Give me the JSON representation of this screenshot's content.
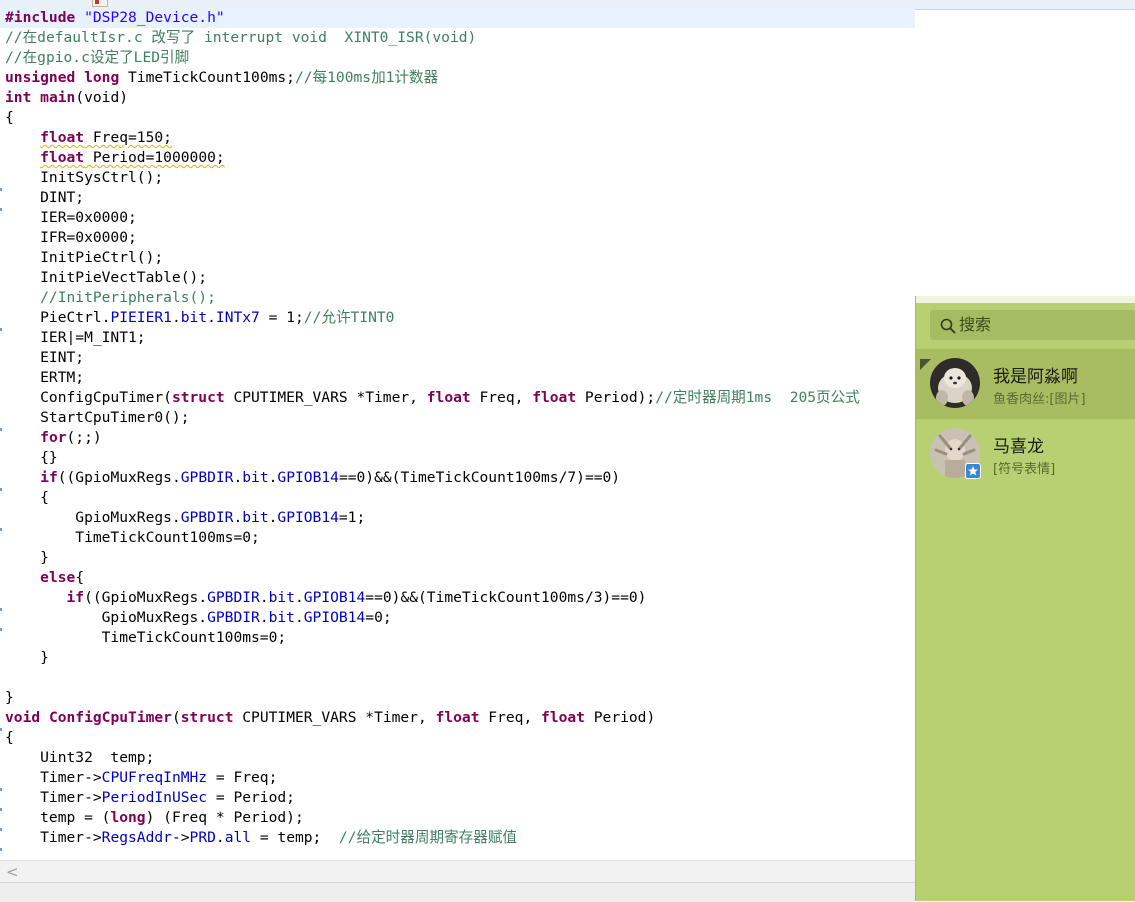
{
  "editor": {
    "lines": [
      [
        {
          "t": "#include ",
          "c": "kw"
        },
        {
          "t": "\"DSP28_Device.h\"",
          "c": "str"
        }
      ],
      [
        {
          "t": "//在defaultIsr.c 改写了 interrupt void  XINT0_ISR(void)",
          "c": "cm"
        }
      ],
      [
        {
          "t": "//在gpio.c设定了LED引脚",
          "c": "cm"
        }
      ],
      [
        {
          "t": "unsigned",
          "c": "kw"
        },
        {
          "t": " "
        },
        {
          "t": "long",
          "c": "kw"
        },
        {
          "t": " TimeTickCount100ms;"
        },
        {
          "t": "//每100ms加1计数器",
          "c": "cm"
        }
      ],
      [
        {
          "t": "int",
          "c": "kw"
        },
        {
          "t": " "
        },
        {
          "t": "main",
          "c": "kw"
        },
        {
          "t": "(void)"
        }
      ],
      [
        {
          "t": "{"
        }
      ],
      [
        {
          "t": "    "
        },
        {
          "t": "float",
          "c": "kw sq"
        },
        {
          "t": " Freq=150;",
          "c": "sq"
        }
      ],
      [
        {
          "t": "    "
        },
        {
          "t": "float",
          "c": "kw sq"
        },
        {
          "t": " Period=1000000;",
          "c": "sq"
        }
      ],
      [
        {
          "t": "    InitSysCtrl();"
        }
      ],
      [
        {
          "t": "    DINT;"
        }
      ],
      [
        {
          "t": "    IER=0x0000;"
        }
      ],
      [
        {
          "t": "    IFR=0x0000;"
        }
      ],
      [
        {
          "t": "    InitPieCtrl();"
        }
      ],
      [
        {
          "t": "    InitPieVectTable();"
        }
      ],
      [
        {
          "t": "    //InitPeripherals();",
          "c": "cm"
        }
      ],
      [
        {
          "t": "    PieCtrl."
        },
        {
          "t": "PIEIER1",
          "c": "fld"
        },
        {
          "t": "."
        },
        {
          "t": "bit",
          "c": "fld"
        },
        {
          "t": "."
        },
        {
          "t": "INTx7",
          "c": "fld"
        },
        {
          "t": " = 1;"
        },
        {
          "t": "//允许TINT0",
          "c": "cm"
        }
      ],
      [
        {
          "t": "    IER|=M_INT1;"
        }
      ],
      [
        {
          "t": "    EINT;"
        }
      ],
      [
        {
          "t": "    ERTM;"
        }
      ],
      [
        {
          "t": "    ConfigCpuTimer("
        },
        {
          "t": "struct",
          "c": "kw"
        },
        {
          "t": " CPUTIMER_VARS *Timer, "
        },
        {
          "t": "float",
          "c": "kw"
        },
        {
          "t": " Freq, "
        },
        {
          "t": "float",
          "c": "kw"
        },
        {
          "t": " Period);"
        },
        {
          "t": "//定时器周期1ms  205页公式",
          "c": "cm"
        }
      ],
      [
        {
          "t": "    StartCpuTimer0();"
        }
      ],
      [
        {
          "t": "    "
        },
        {
          "t": "for",
          "c": "kw"
        },
        {
          "t": "(;;)"
        }
      ],
      [
        {
          "t": "    {}"
        }
      ],
      [
        {
          "t": "    "
        },
        {
          "t": "if",
          "c": "kw"
        },
        {
          "t": "((GpioMuxRegs."
        },
        {
          "t": "GPBDIR",
          "c": "fld"
        },
        {
          "t": "."
        },
        {
          "t": "bit",
          "c": "fld"
        },
        {
          "t": "."
        },
        {
          "t": "GPIOB14",
          "c": "fld"
        },
        {
          "t": "==0)&&(TimeTickCount100ms/7)==0)"
        }
      ],
      [
        {
          "t": "    {"
        }
      ],
      [
        {
          "t": "        GpioMuxRegs."
        },
        {
          "t": "GPBDIR",
          "c": "fld"
        },
        {
          "t": "."
        },
        {
          "t": "bit",
          "c": "fld"
        },
        {
          "t": "."
        },
        {
          "t": "GPIOB14",
          "c": "fld"
        },
        {
          "t": "=1;"
        }
      ],
      [
        {
          "t": "        TimeTickCount100ms=0;"
        }
      ],
      [
        {
          "t": "    }"
        }
      ],
      [
        {
          "t": "    "
        },
        {
          "t": "else",
          "c": "kw"
        },
        {
          "t": "{"
        }
      ],
      [
        {
          "t": "       "
        },
        {
          "t": "if",
          "c": "kw"
        },
        {
          "t": "((GpioMuxRegs."
        },
        {
          "t": "GPBDIR",
          "c": "fld"
        },
        {
          "t": "."
        },
        {
          "t": "bit",
          "c": "fld"
        },
        {
          "t": "."
        },
        {
          "t": "GPIOB14",
          "c": "fld"
        },
        {
          "t": "==0)&&(TimeTickCount100ms/3)==0)"
        }
      ],
      [
        {
          "t": "           GpioMuxRegs."
        },
        {
          "t": "GPBDIR",
          "c": "fld"
        },
        {
          "t": "."
        },
        {
          "t": "bit",
          "c": "fld"
        },
        {
          "t": "."
        },
        {
          "t": "GPIOB14",
          "c": "fld"
        },
        {
          "t": "=0;"
        }
      ],
      [
        {
          "t": "           TimeTickCount100ms=0;"
        }
      ],
      [
        {
          "t": "    }"
        }
      ],
      [
        {
          "t": ""
        }
      ],
      [
        {
          "t": "}"
        }
      ],
      [
        {
          "t": "void",
          "c": "kw"
        },
        {
          "t": " "
        },
        {
          "t": "ConfigCpuTimer",
          "c": "kw"
        },
        {
          "t": "("
        },
        {
          "t": "struct",
          "c": "kw"
        },
        {
          "t": " CPUTIMER_VARS *Timer, "
        },
        {
          "t": "float",
          "c": "kw"
        },
        {
          "t": " Freq, "
        },
        {
          "t": "float",
          "c": "kw"
        },
        {
          "t": " Period)"
        }
      ],
      [
        {
          "t": "{"
        }
      ],
      [
        {
          "t": "    Uint32  temp;"
        }
      ],
      [
        {
          "t": "    Timer->"
        },
        {
          "t": "CPUFreqInMHz",
          "c": "fld"
        },
        {
          "t": " = Freq;"
        }
      ],
      [
        {
          "t": "    Timer->"
        },
        {
          "t": "PeriodInUSec",
          "c": "fld"
        },
        {
          "t": " = Period;"
        }
      ],
      [
        {
          "t": "    temp = ("
        },
        {
          "t": "long",
          "c": "kw"
        },
        {
          "t": ") (Freq * Period);"
        }
      ],
      [
        {
          "t": "    Timer->"
        },
        {
          "t": "RegsAddr",
          "c": "fld"
        },
        {
          "t": "->"
        },
        {
          "t": "PRD",
          "c": "fld"
        },
        {
          "t": "."
        },
        {
          "t": "all",
          "c": "fld"
        },
        {
          "t": " = temp;  "
        },
        {
          "t": "//给定时器周期寄存器赋值",
          "c": "cm"
        }
      ]
    ],
    "highlighted_line": 0,
    "scroll_left_arrow": "<"
  },
  "chat": {
    "search_placeholder": "搜索",
    "contacts": [
      {
        "name": "我是阿淼啊",
        "preview": "鱼香肉丝:[图片]",
        "selected": true,
        "pinned": true
      },
      {
        "name": "马喜龙",
        "preview": "[符号表情]",
        "selected": false,
        "pinned": false
      }
    ]
  },
  "colors": {
    "keyword": "#7f0055",
    "string": "#2a00ff",
    "comment": "#3f7f5f",
    "field": "#0000c0",
    "chat_panel_bg": "#b7d072"
  }
}
